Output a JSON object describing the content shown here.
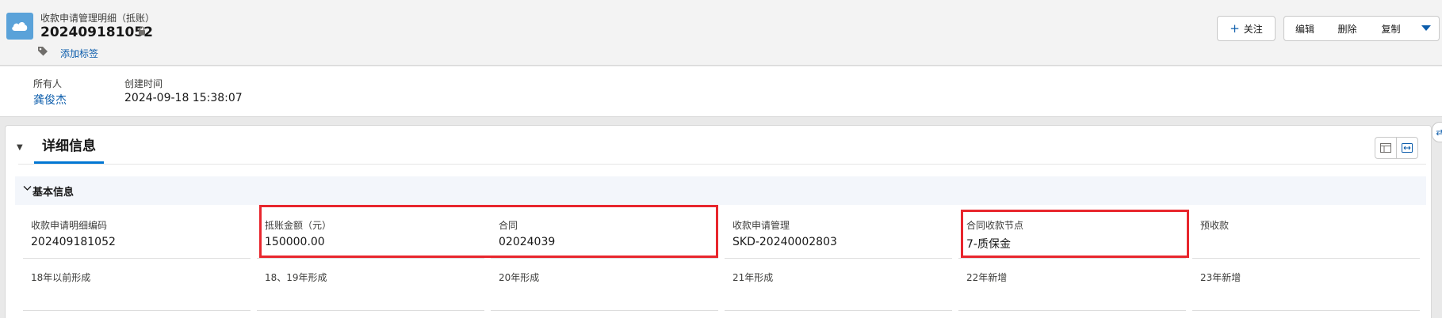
{
  "header": {
    "object_type": "收款申请管理明细（抵账）",
    "record_title": "202409181052",
    "add_tag_label": "添加标签",
    "buttons": {
      "follow": "关注",
      "edit": "编辑",
      "delete": "删除",
      "copy": "复制"
    }
  },
  "highlights": {
    "owner_label": "所有人",
    "owner_value": "龚俊杰",
    "created_label": "创建时间",
    "created_value": "2024-09-18 15:38:07"
  },
  "detail": {
    "tab_label": "详细信息",
    "section_title": "基本信息",
    "fields": [
      {
        "label": "收款申请明细编码",
        "value": "202409181052"
      },
      {
        "label": "抵账金额（元）",
        "value": "150000.00"
      },
      {
        "label": "合同",
        "value": "02024039"
      },
      {
        "label": "收款申请管理",
        "value": "SKD-20240002803"
      },
      {
        "label": "合同收款节点",
        "value": "7-质保金"
      },
      {
        "label": "预收款",
        "value": ""
      },
      {
        "label": "18年以前形成",
        "value": ""
      },
      {
        "label": "18、19年形成",
        "value": ""
      },
      {
        "label": "20年形成",
        "value": ""
      },
      {
        "label": "21年形成",
        "value": ""
      },
      {
        "label": "22年新增",
        "value": ""
      },
      {
        "label": "23年新增",
        "value": ""
      }
    ]
  },
  "colors": {
    "link": "#0b5cab",
    "highlight_box": "#e8262d",
    "app_icon": "#5aa2d9",
    "active_tab": "#0176d3"
  }
}
